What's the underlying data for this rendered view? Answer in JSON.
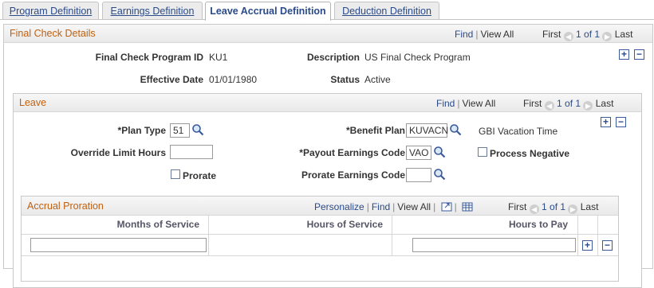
{
  "tabs": [
    {
      "label": "Program Definition"
    },
    {
      "label": "Earnings Definition"
    },
    {
      "label": "Leave Accrual Definition"
    },
    {
      "label": "Deduction Definition"
    }
  ],
  "final_check": {
    "title": "Final Check Details",
    "nav": {
      "find": "Find",
      "view_all": "View All",
      "first": "First",
      "count": "1 of 1",
      "last": "Last"
    },
    "fields": {
      "program_id_label": "Final Check Program ID",
      "program_id_value": "KU1",
      "description_label": "Description",
      "description_value": "US Final Check Program",
      "effective_date_label": "Effective Date",
      "effective_date_value": "01/01/1980",
      "status_label": "Status",
      "status_value": "Active"
    }
  },
  "leave": {
    "title": "Leave",
    "nav": {
      "find": "Find",
      "view_all": "View All",
      "first": "First",
      "count": "1 of 1",
      "last": "Last"
    },
    "plan_type_label": "*Plan Type",
    "plan_type_value": "51",
    "benefit_plan_label": "*Benefit Plan",
    "benefit_plan_value": "KUVACN",
    "benefit_plan_desc": "GBI Vacation Time",
    "override_limit_label": "Override Limit Hours",
    "override_limit_value": "",
    "payout_earnings_label": "*Payout Earnings Code",
    "payout_earnings_value": "VAO",
    "process_negative_label": "Process Negative",
    "prorate_label": "Prorate",
    "prorate_earnings_label": "Prorate Earnings Code",
    "prorate_earnings_value": ""
  },
  "accrual": {
    "title": "Accrual Proration",
    "nav": {
      "personalize": "Personalize",
      "find": "Find",
      "view_all": "View All",
      "first": "First",
      "count": "1 of 1",
      "last": "Last"
    },
    "columns": [
      "Months of Service",
      "Hours of Service",
      "Hours to Pay"
    ],
    "rows": [
      {
        "months": "",
        "hours_of_service": "",
        "hours_to_pay": ""
      }
    ]
  },
  "buttons": {
    "add": "+",
    "delete": "−"
  },
  "icons": {
    "prev": "◀",
    "next": "▶"
  }
}
